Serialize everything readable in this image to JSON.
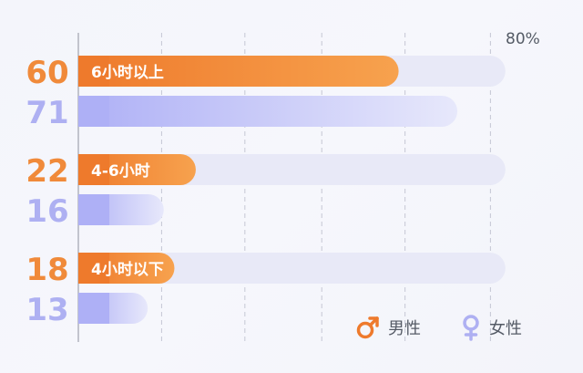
{
  "chart_data": {
    "type": "bar",
    "orientation": "horizontal",
    "categories": [
      "6小时以上",
      "4-6小时",
      "4小时以下"
    ],
    "series": [
      {
        "name": "男性",
        "values": [
          60,
          22,
          18
        ]
      },
      {
        "name": "女性",
        "values": [
          71,
          16,
          13
        ]
      }
    ],
    "xlim": [
      0,
      80
    ],
    "max_label": "80%",
    "grid": true,
    "legend_position": "bottom-right"
  },
  "legend": {
    "male_label": "男性",
    "female_label": "女性",
    "male_icon": "male-symbol-icon",
    "female_icon": "female-symbol-icon"
  },
  "colors": {
    "male_start": "#ee7a2c",
    "male_end": "#f7a24e",
    "female_start": "#aeb0f6",
    "female_end": "#e7e8fb",
    "track": "#e8e9f7",
    "grid": "#c5c7d4",
    "male_value": "#f08a3a",
    "female_value": "#aeb0f2"
  }
}
